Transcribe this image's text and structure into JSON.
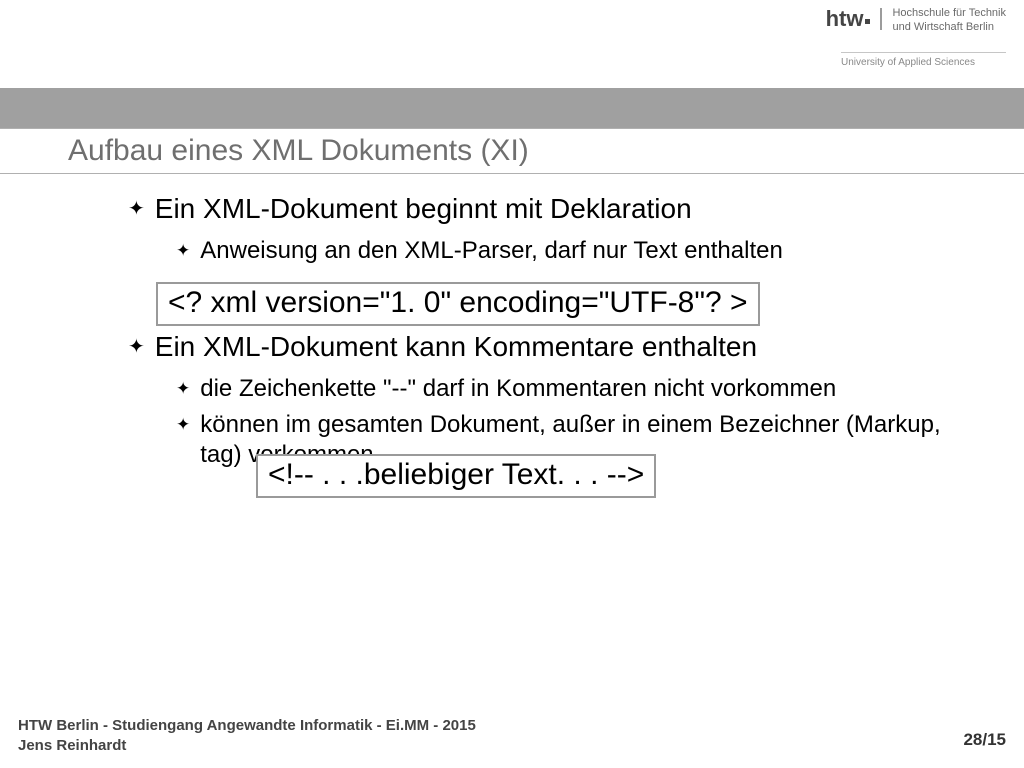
{
  "logo": {
    "mark": "htw",
    "text_line1": "Hochschule für Technik",
    "text_line2": "und Wirtschaft Berlin",
    "sub": "University of Applied Sciences"
  },
  "title": "Aufbau eines XML Dokuments (XI)",
  "bullets": {
    "p1": "Ein XML-Dokument beginnt mit Deklaration",
    "p1_1": "Anweisung an den XML-Parser, darf nur Text enthalten",
    "code1": "<? xml version=\"1. 0\" encoding=\"UTF-8\"? >",
    "p2": "Ein XML-Dokument kann Kommentare enthalten",
    "p2_1": "die Zeichenkette \"--\" darf in Kommentaren nicht vorkommen",
    "p2_2": "können im gesamten Dokument, außer in einem Bezeichner (Markup, tag) vorkommen",
    "code2": "<!-- . . .beliebiger Text. . .  -->"
  },
  "footer": {
    "line1": "HTW Berlin - Studiengang Angewandte Informatik - Ei.MM - 2015",
    "line2": "Jens Reinhardt",
    "page": "28/15"
  }
}
